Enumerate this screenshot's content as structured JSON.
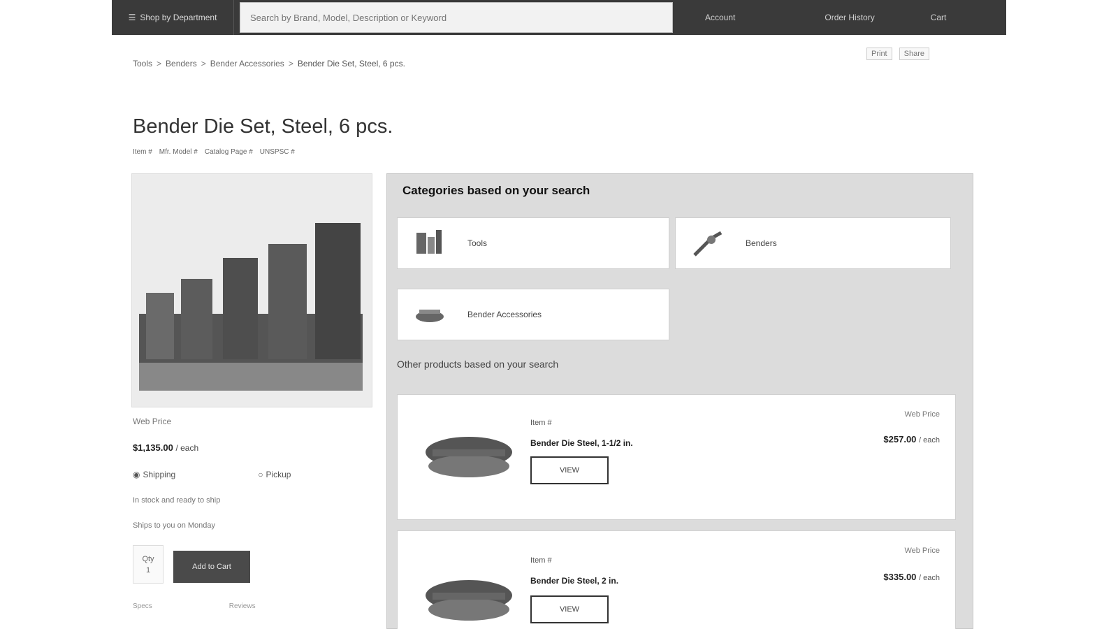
{
  "header": {
    "menu_label": "Shop by Department",
    "search_placeholder": "Search by Brand, Model, Description or Keyword",
    "account_label": "Account",
    "orders_label": "Order History",
    "cart_label": "Cart"
  },
  "breadcrumb": [
    "Tools",
    "Benders",
    "Bender Accessories",
    "Bender Die Set, Steel, 6 pcs."
  ],
  "util_links": [
    "Print",
    "Share"
  ],
  "product": {
    "title": "Bender Die Set, Steel, 6 pcs.",
    "meta": [
      "Item #",
      "Mfr. Model #",
      "Catalog Page #",
      "UNSPSC #"
    ],
    "price_label": "Web Price",
    "price": "$1,135.00",
    "price_unit": "/ each",
    "shipping_option": "Shipping",
    "pickup_option": "Pickup",
    "stock_text": "In stock and ready to ship",
    "ship_text": "Ships to you on Monday",
    "qty_label": "Qty",
    "qty_value": "1",
    "add_to_cart": "Add to Cart",
    "bottom_links": [
      "Specs",
      "Reviews"
    ]
  },
  "categories_panel": {
    "title": "Categories based on your search",
    "cards": [
      {
        "label": "Tools",
        "icon": "tools-icon"
      },
      {
        "label": "Benders",
        "icon": "bender-icon"
      },
      {
        "label": "Bender Accessories",
        "icon": "bender-accessory-icon"
      }
    ],
    "related_heading": "Other products based on your search",
    "items": [
      {
        "sku": "Item #",
        "name": "Bender Die Steel, 1-1/2 in.",
        "view": "VIEW",
        "wp_label": "Web Price",
        "price": "$257.00",
        "unit": "/ each"
      },
      {
        "sku": "Item #",
        "name": "Bender Die Steel, 2 in.",
        "view": "VIEW",
        "wp_label": "Web Price",
        "price": "$335.00",
        "unit": "/ each"
      }
    ]
  },
  "colors": {
    "topbar": "#3a3a3a",
    "panel": "#dcdcdc",
    "button": "#4a4a4a"
  }
}
